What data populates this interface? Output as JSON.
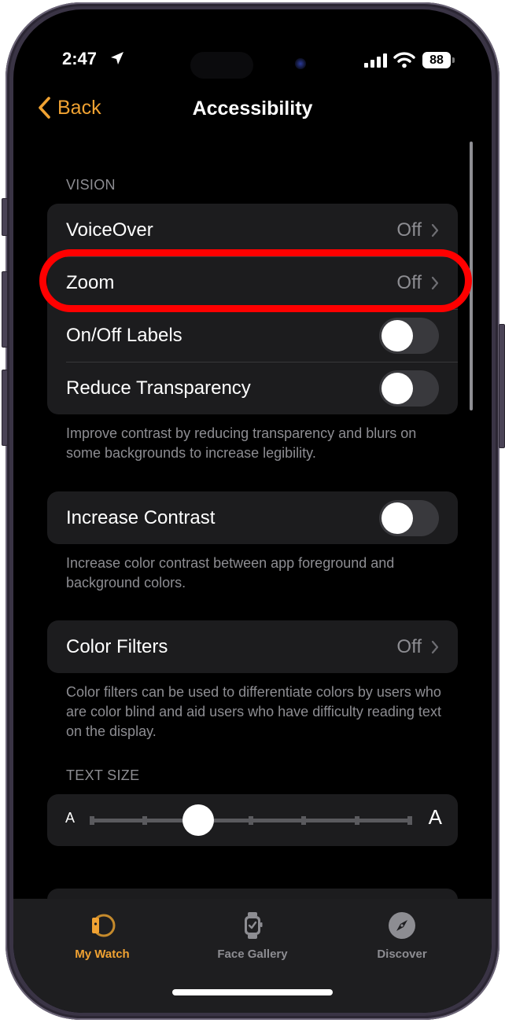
{
  "status_bar": {
    "time": "2:47",
    "battery_percent": "88"
  },
  "nav": {
    "back_label": "Back",
    "title": "Accessibility"
  },
  "vision": {
    "header": "VISION",
    "rows": [
      {
        "label": "VoiceOver",
        "value": "Off",
        "type": "link"
      },
      {
        "label": "Zoom",
        "value": "Off",
        "type": "link",
        "highlighted": true
      },
      {
        "label": "On/Off Labels",
        "type": "toggle",
        "on": false
      },
      {
        "label": "Reduce Transparency",
        "type": "toggle",
        "on": false
      }
    ],
    "footer": "Improve contrast by reducing transparency and blurs on some backgrounds to increase legibility."
  },
  "contrast": {
    "label": "Increase Contrast",
    "on": false,
    "footer": "Increase color contrast between app foreground and background colors."
  },
  "color_filters": {
    "label": "Color Filters",
    "value": "Off",
    "footer": "Color filters can be used to differentiate colors by users who are color blind and aid users who have difficulty reading text on the display."
  },
  "text_size": {
    "header": "TEXT SIZE",
    "small_glyph": "A",
    "large_glyph": "A",
    "steps": 7,
    "selected_step": 2
  },
  "tabbar": {
    "tabs": [
      {
        "label": "My Watch",
        "icon": "watch-band-icon",
        "active": true
      },
      {
        "label": "Face Gallery",
        "icon": "watch-face-icon",
        "active": false
      },
      {
        "label": "Discover",
        "icon": "compass-icon",
        "active": false
      }
    ]
  },
  "colors": {
    "accent": "#f0a232",
    "highlight_ring": "#ff0000",
    "card_bg": "#1c1c1e",
    "secondary_text": "#8d8d92"
  }
}
